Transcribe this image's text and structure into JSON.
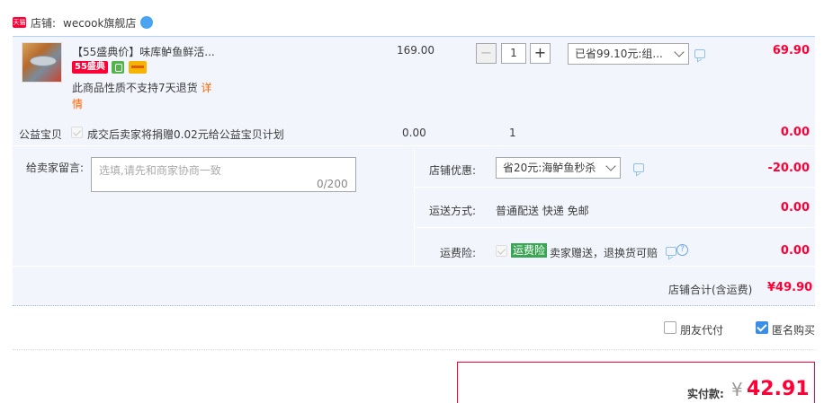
{
  "shop": {
    "badge": "天猫",
    "label": "店铺:",
    "name": "wecook旗舰店"
  },
  "item": {
    "title": "【55盛典价】味库鲈鱼鲜活...",
    "promo_badge": "55盛典",
    "notice": "此商品性质不支持7天退货",
    "detail_link_part1": "详",
    "detail_link_part2": "情",
    "unit_price": "169.00",
    "quantity": "1",
    "qty_minus": "−",
    "qty_plus": "+",
    "promo_selected": "已省99.10元:组...",
    "total": "69.90"
  },
  "charity": {
    "label": "公益宝贝",
    "text": "成交后卖家将捐赠0.02元给公益宝贝计划",
    "price": "0.00",
    "quantity": "1",
    "total": "0.00"
  },
  "order": {
    "message_label": "给卖家留言:",
    "message_placeholder": "选填,请先和商家协商一致",
    "message_count": "0/200",
    "shop_discount_label": "店铺优惠:",
    "shop_discount_selected": "省20元:海鲈鱼秒杀",
    "shop_discount_amount": "-20.00",
    "shipping_label": "运送方式:",
    "shipping_value": "普通配送 快递 免邮",
    "shipping_amount": "0.00",
    "insurance_label": "运费险:",
    "insurance_tag": "运费险",
    "insurance_text": "卖家赠送，退换货可赔",
    "insurance_amount": "0.00",
    "help_glyph": "?",
    "store_total_label": "店铺合计(含运费)",
    "store_total_value": "¥49.90"
  },
  "options": {
    "friend_pay_label": "朋友代付",
    "friend_pay_checked": false,
    "anonymous_label": "匿名购买",
    "anonymous_checked": true
  },
  "payment": {
    "label": "实付款:",
    "currency": "¥",
    "amount": "42.91"
  },
  "colors": {
    "accent_red": "#ff0036",
    "panel_bg": "#f2f5fc",
    "checkbox_blue": "#3a8ee6",
    "insurance_green": "#3aa653"
  }
}
